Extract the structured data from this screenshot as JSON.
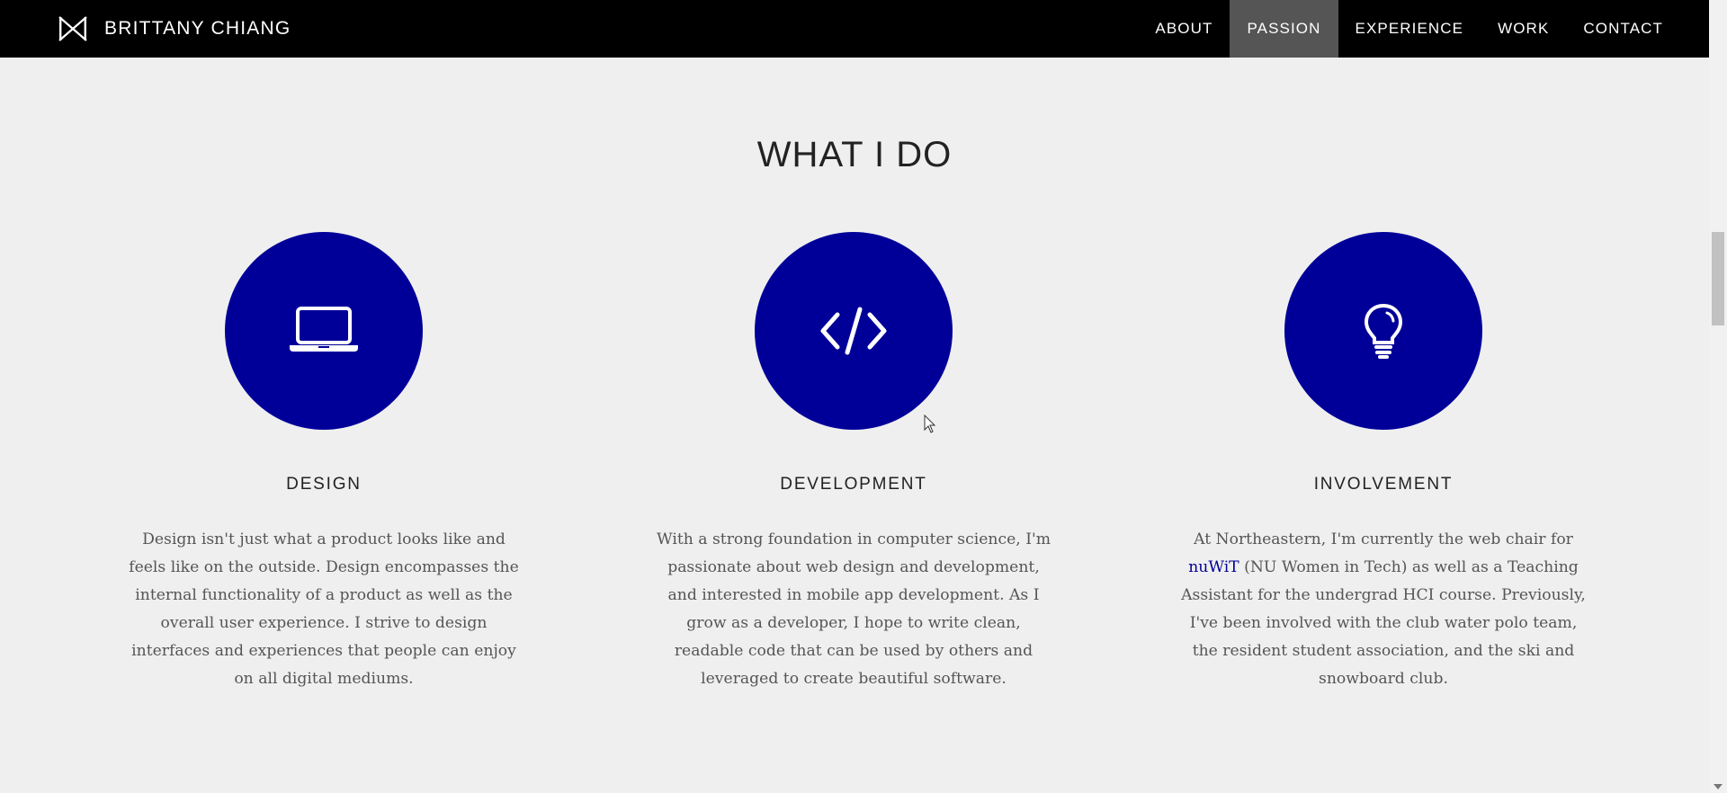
{
  "nav": {
    "brand": "BRITTANY CHIANG",
    "links": [
      {
        "label": "ABOUT"
      },
      {
        "label": "PASSION",
        "active": true
      },
      {
        "label": "EXPERIENCE"
      },
      {
        "label": "WORK"
      },
      {
        "label": "CONTACT"
      }
    ]
  },
  "section": {
    "title": "WHAT I DO",
    "items": [
      {
        "icon": "laptop-icon",
        "title": "DESIGN",
        "text": "Design isn't just what a product looks like and feels like on the outside. Design encompasses the internal functionality of a product as well as the overall user experience. I strive to design interfaces and experiences that people can enjoy on all digital mediums."
      },
      {
        "icon": "code-icon",
        "title": "DEVELOPMENT",
        "text": "With a strong foundation in computer science, I'm passionate about web design and development, and interested in mobile app development. As I grow as a developer, I hope to write clean, readable code that can be used by others and leveraged to create beautiful software."
      },
      {
        "icon": "lightbulb-icon",
        "title": "INVOLVEMENT",
        "text_before": "At Northeastern, I'm currently the web chair for",
        "link": "nuWiT",
        "text_after": "(NU Women in Tech) as well as a Teaching Assistant for the undergrad HCI course. Previously, I've been involved with the club water polo team, the resident student association, and the ski and snowboard club."
      }
    ]
  },
  "colors": {
    "accent": "#000099",
    "nav_bg": "#000000",
    "nav_active": "#555555",
    "page_bg": "#efefef"
  }
}
